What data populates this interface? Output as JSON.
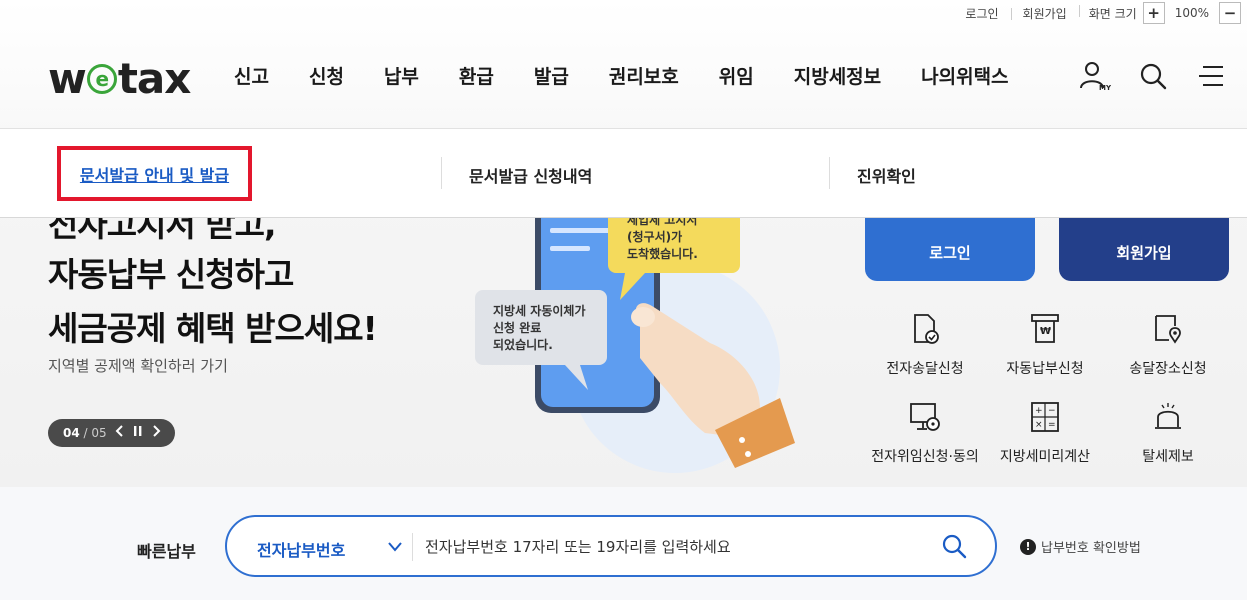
{
  "utility": {
    "login": "로그인",
    "signup": "회원가입",
    "zoom_label": "화면 크기",
    "zoom_in": "+",
    "zoom_value": "100%",
    "zoom_out": "−"
  },
  "logo": {
    "pre": "w",
    "mid": "e",
    "post": "tax"
  },
  "nav": {
    "items": [
      "신고",
      "신청",
      "납부",
      "환급",
      "발급",
      "권리보호",
      "위임",
      "지방세정보",
      "나의위택스"
    ],
    "icons": [
      "user-my-icon",
      "search-icon",
      "menu-icon"
    ],
    "my_badge": "MY"
  },
  "submenu": {
    "selected": "문서발급 안내 및 발급",
    "item2": "문서발급 신청내역",
    "item3": "진위확인",
    "highlight_color": "#e3172d"
  },
  "hero": {
    "line1": "전자고지서 받고,",
    "line2": "자동납부 신청하고",
    "line3": "세금공제 혜택 받으세요!",
    "sub": "지역별 공제액 확인하러 가기",
    "slide_current": "04",
    "slide_total": "/ 05",
    "bubble1": [
      "세입세 고지서",
      "(청구서)가",
      "도착했습니다."
    ],
    "bubble2": [
      "지방세 자동이체가",
      "신청 완료",
      "되었습니다."
    ]
  },
  "quick": {
    "login": "로그인",
    "signup": "회원가입",
    "services": [
      {
        "label": "전자송달신청",
        "icon": "document-check-icon"
      },
      {
        "label": "자동납부신청",
        "icon": "auto-pay-icon"
      },
      {
        "label": "송달장소신청",
        "icon": "location-doc-icon"
      },
      {
        "label": "전자위임신청·동의",
        "icon": "monitor-lock-icon"
      },
      {
        "label": "지방세미리계산",
        "icon": "calculator-icon"
      },
      {
        "label": "탈세제보",
        "icon": "alarm-bell-icon"
      }
    ]
  },
  "quickpay": {
    "label": "빠른납부",
    "select_value": "전자납부번호",
    "placeholder": "전자납부번호 17자리 또는 19자리를 입력하세요",
    "help": "납부번호 확인방법"
  },
  "colors": {
    "primary": "#2f6fd1",
    "navy": "#233f8a",
    "logo_green": "#3aa53a"
  }
}
